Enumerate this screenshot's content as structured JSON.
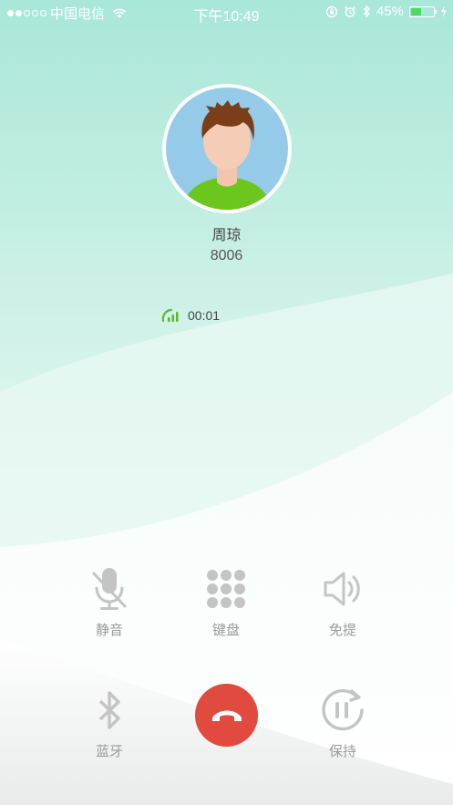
{
  "status_bar": {
    "carrier": "中国电信",
    "time": "下午10:49",
    "battery_percent": "45%",
    "battery_level": 0.45,
    "signal_bars_filled": 2,
    "signal_bars_total": 5
  },
  "caller": {
    "name": "周琼",
    "number": "8006"
  },
  "call": {
    "duration": "00:01",
    "signal_color": "#5fb82e"
  },
  "controls": {
    "mute_label": "静音",
    "keypad_label": "键盘",
    "speaker_label": "免提",
    "bluetooth_label": "蓝牙",
    "hold_label": "保持"
  },
  "colors": {
    "hangup": "#e04a3f",
    "accent_mint": "#a8e6d6",
    "control_gray": "#c4c4c4"
  }
}
